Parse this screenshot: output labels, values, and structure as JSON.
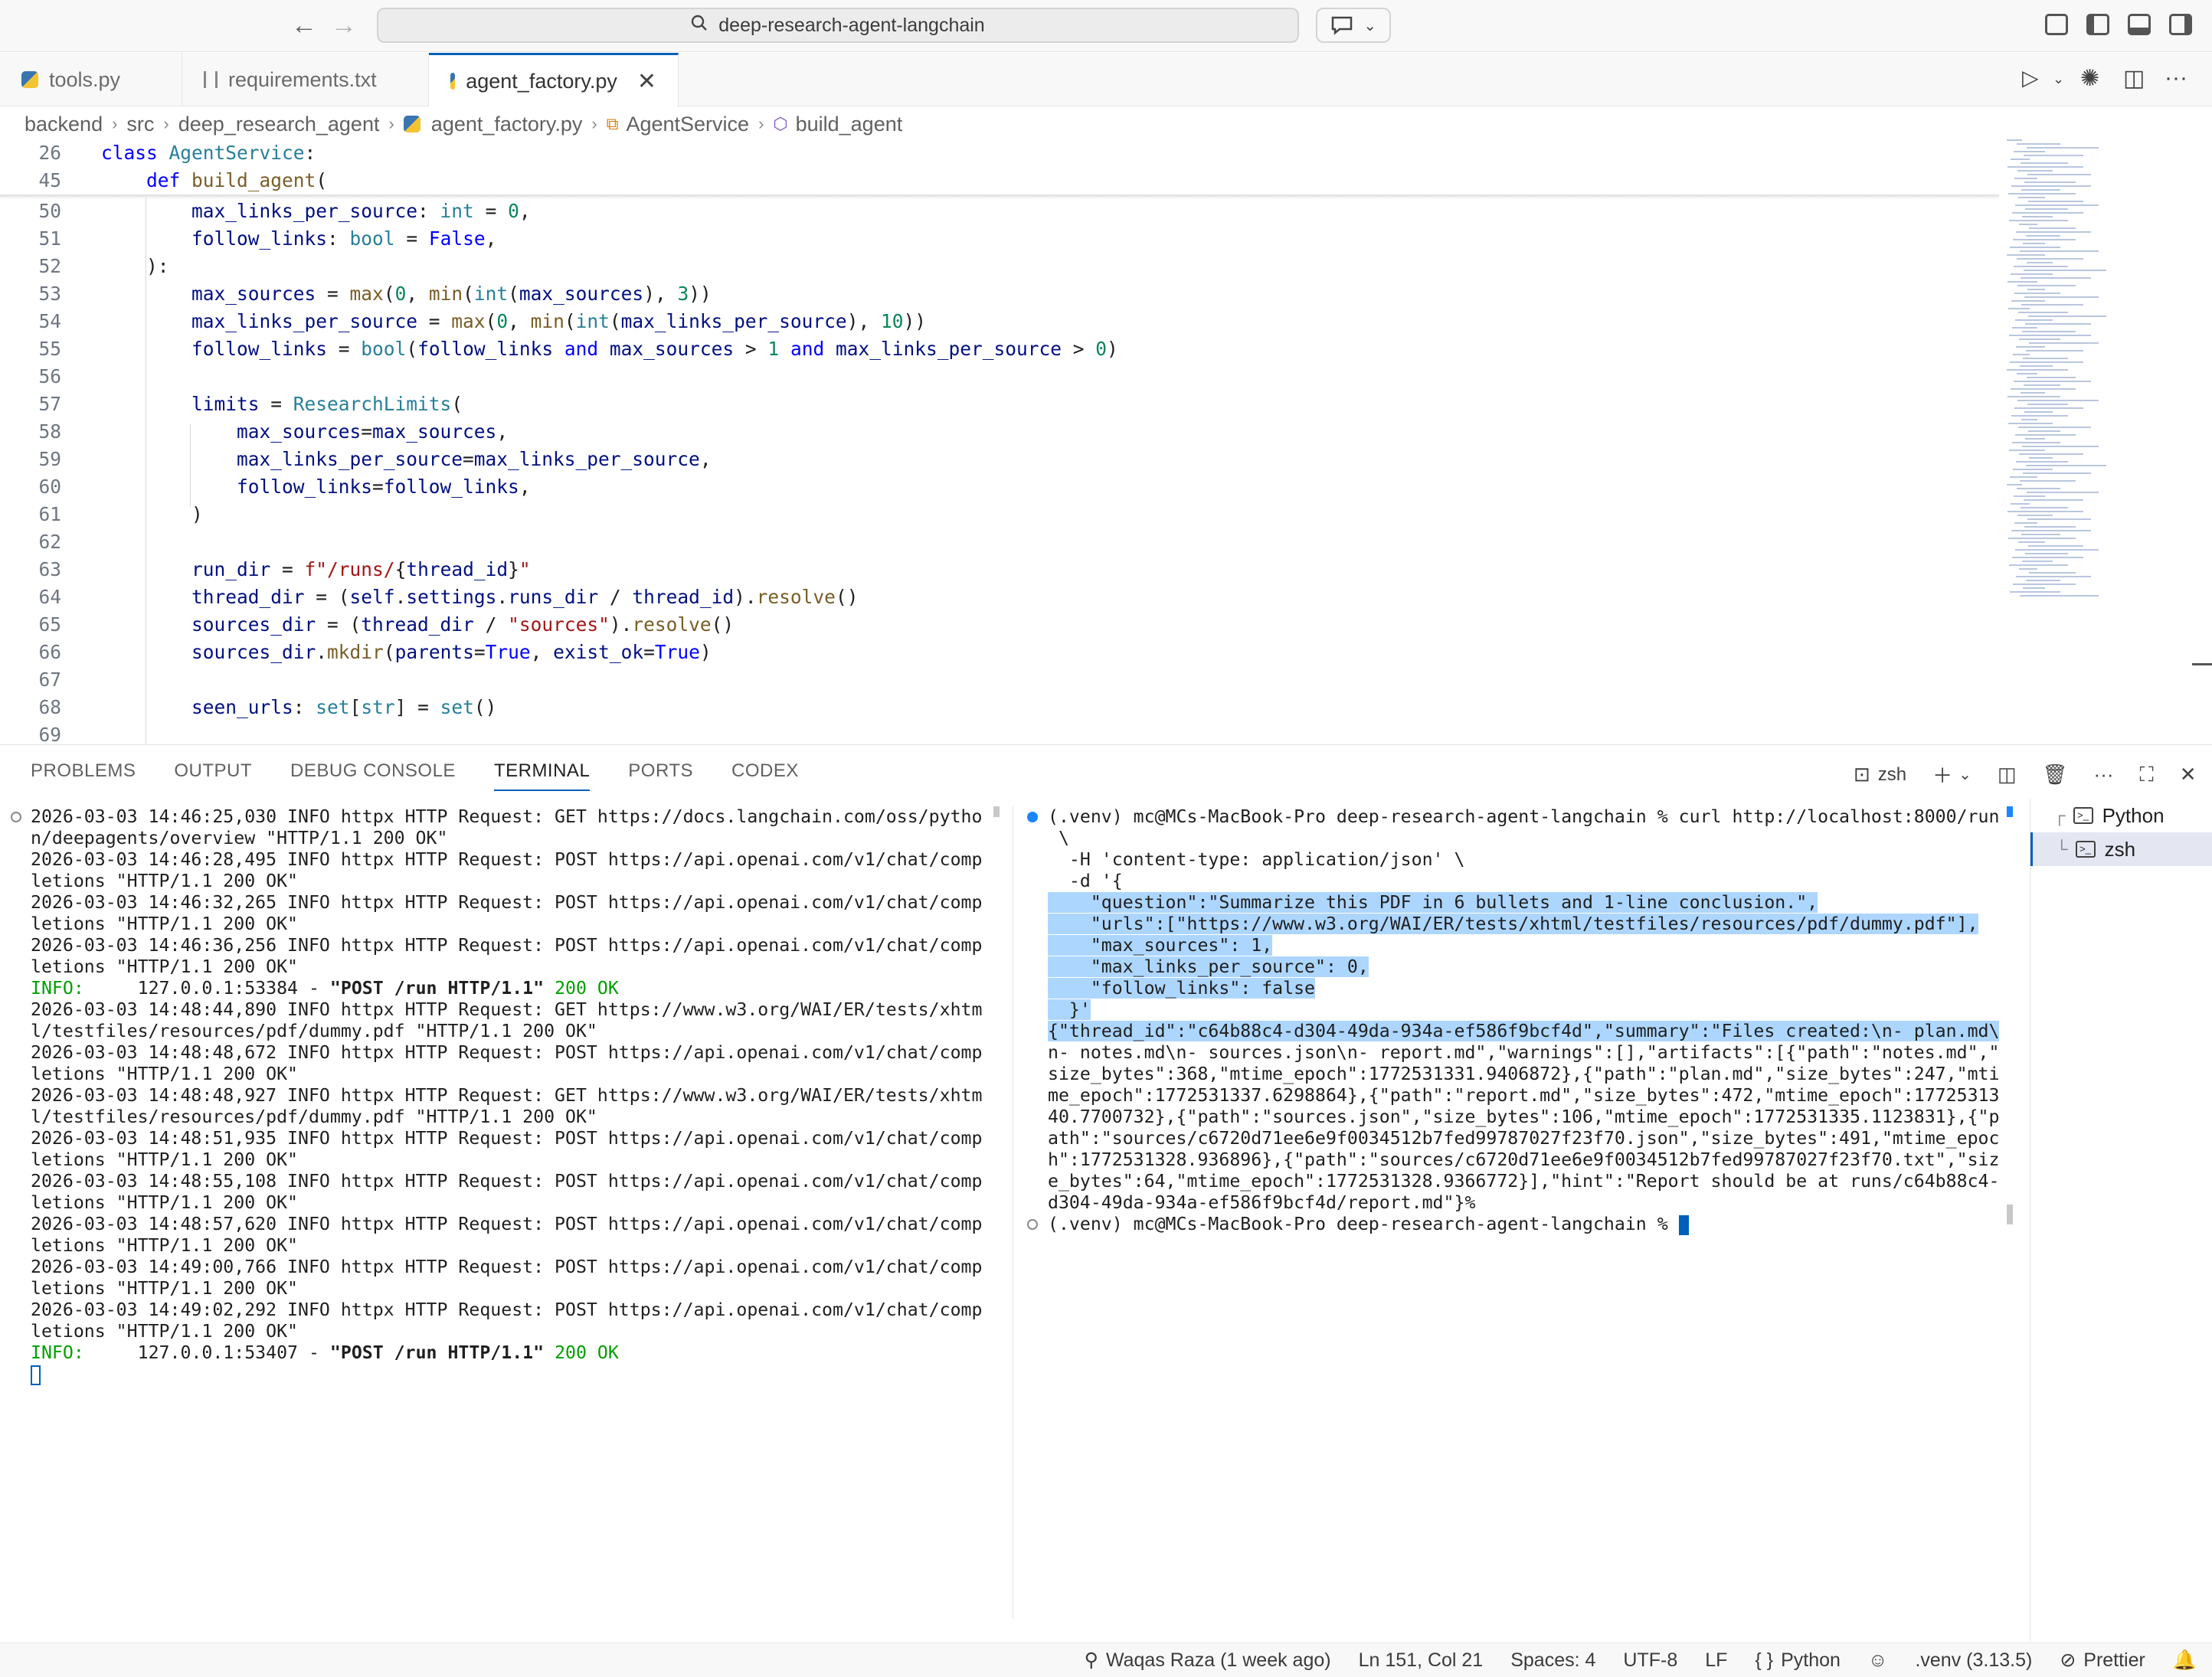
{
  "search": {
    "text": "deep-research-agent-langchain"
  },
  "tabs": [
    {
      "label": "tools.py"
    },
    {
      "label": "requirements.txt"
    },
    {
      "label": "agent_factory.py"
    }
  ],
  "breadcrumb": [
    "backend",
    "src",
    "deep_research_agent",
    "agent_factory.py",
    "AgentService",
    "build_agent"
  ],
  "editor": {
    "sticky": [
      {
        "ln": "26",
        "html": "<span class=\"kw\">class</span> <span class=\"cls\">AgentService</span>:"
      },
      {
        "ln": "45",
        "html": "    <span class=\"kw\">def</span> <span class=\"fn\">build_agent</span>("
      }
    ],
    "lines": [
      {
        "ln": "50",
        "html": "        <span class=\"var\">max_links_per_source</span>: <span class=\"ty\">int</span> = <span class=\"num\">0</span>,"
      },
      {
        "ln": "51",
        "html": "        <span class=\"var\">follow_links</span>: <span class=\"ty\">bool</span> = <span class=\"kw\">False</span>,"
      },
      {
        "ln": "52",
        "html": "    ):"
      },
      {
        "ln": "53",
        "html": "        <span class=\"var\">max_sources</span> = <span class=\"fn\">max</span>(<span class=\"num\">0</span>, <span class=\"fn\">min</span>(<span class=\"ty\">int</span>(<span class=\"var\">max_sources</span>), <span class=\"num\">3</span>))"
      },
      {
        "ln": "54",
        "html": "        <span class=\"var\">max_links_per_source</span> = <span class=\"fn\">max</span>(<span class=\"num\">0</span>, <span class=\"fn\">min</span>(<span class=\"ty\">int</span>(<span class=\"var\">max_links_per_source</span>), <span class=\"num\">10</span>))"
      },
      {
        "ln": "55",
        "html": "        <span class=\"var\">follow_links</span> = <span class=\"ty\">bool</span>(<span class=\"var\">follow_links</span> <span class=\"kw\">and</span> <span class=\"var\">max_sources</span> > <span class=\"num\">1</span> <span class=\"kw\">and</span> <span class=\"var\">max_links_per_source</span> > <span class=\"num\">0</span>)"
      },
      {
        "ln": "56",
        "html": ""
      },
      {
        "ln": "57",
        "html": "        <span class=\"var\">limits</span> = <span class=\"cls\">ResearchLimits</span>("
      },
      {
        "ln": "58",
        "html": "            <span class=\"var\">max_sources</span>=<span class=\"var\">max_sources</span>,"
      },
      {
        "ln": "59",
        "html": "            <span class=\"var\">max_links_per_source</span>=<span class=\"var\">max_links_per_source</span>,"
      },
      {
        "ln": "60",
        "html": "            <span class=\"var\">follow_links</span>=<span class=\"var\">follow_links</span>,"
      },
      {
        "ln": "61",
        "html": "        )"
      },
      {
        "ln": "62",
        "html": ""
      },
      {
        "ln": "63",
        "html": "        <span class=\"var\">run_dir</span> = <span class=\"str\">f\"/runs/</span>{<span class=\"var\">thread_id</span>}<span class=\"str\">\"</span>"
      },
      {
        "ln": "64",
        "html": "        <span class=\"var\">thread_dir</span> = (<span class=\"var\">self</span>.<span class=\"var\">settings</span>.<span class=\"var\">runs_dir</span> / <span class=\"var\">thread_id</span>).<span class=\"fn\">resolve</span>()"
      },
      {
        "ln": "65",
        "html": "        <span class=\"var\">sources_dir</span> = (<span class=\"var\">thread_dir</span> / <span class=\"str\">\"sources\"</span>).<span class=\"fn\">resolve</span>()"
      },
      {
        "ln": "66",
        "html": "        <span class=\"var\">sources_dir</span>.<span class=\"fn\">mkdir</span>(<span class=\"var\">parents</span>=<span class=\"kw\">True</span>, <span class=\"var\">exist_ok</span>=<span class=\"kw\">True</span>)"
      },
      {
        "ln": "67",
        "html": ""
      },
      {
        "ln": "68",
        "html": "        <span class=\"var\">seen_urls</span>: <span class=\"ty\">set</span>[<span class=\"ty\">str</span>] = <span class=\"ty\">set</span>()"
      },
      {
        "ln": "69",
        "html": ""
      }
    ]
  },
  "panel": {
    "tabs": [
      "PROBLEMS",
      "OUTPUT",
      "DEBUG CONSOLE",
      "TERMINAL",
      "PORTS",
      "CODEX"
    ],
    "active_tab": "TERMINAL",
    "shell_label": "zsh",
    "terminals": [
      "Python",
      "zsh"
    ]
  },
  "terminal_left": [
    "2026-03-03 14:46:25,030 INFO httpx HTTP Request: GET https://docs.langchain.com/oss/pytho",
    "n/deepagents/overview \"HTTP/1.1 200 OK\"",
    "2026-03-03 14:46:28,495 INFO httpx HTTP Request: POST https://api.openai.com/v1/chat/comp",
    "letions \"HTTP/1.1 200 OK\"",
    "2026-03-03 14:46:32,265 INFO httpx HTTP Request: POST https://api.openai.com/v1/chat/comp",
    "letions \"HTTP/1.1 200 OK\"",
    "2026-03-03 14:46:36,256 INFO httpx HTTP Request: POST https://api.openai.com/v1/chat/comp",
    "letions \"HTTP/1.1 200 OK\"",
    "INFO:     127.0.0.1:53384 - \"POST /run HTTP/1.1\" 200 OK",
    "2026-03-03 14:48:44,890 INFO httpx HTTP Request: GET https://www.w3.org/WAI/ER/tests/xhtm",
    "l/testfiles/resources/pdf/dummy.pdf \"HTTP/1.1 200 OK\"",
    "2026-03-03 14:48:48,672 INFO httpx HTTP Request: POST https://api.openai.com/v1/chat/comp",
    "letions \"HTTP/1.1 200 OK\"",
    "2026-03-03 14:48:48,927 INFO httpx HTTP Request: GET https://www.w3.org/WAI/ER/tests/xhtm",
    "l/testfiles/resources/pdf/dummy.pdf \"HTTP/1.1 200 OK\"",
    "2026-03-03 14:48:51,935 INFO httpx HTTP Request: POST https://api.openai.com/v1/chat/comp",
    "letions \"HTTP/1.1 200 OK\"",
    "2026-03-03 14:48:55,108 INFO httpx HTTP Request: POST https://api.openai.com/v1/chat/comp",
    "letions \"HTTP/1.1 200 OK\"",
    "2026-03-03 14:48:57,620 INFO httpx HTTP Request: POST https://api.openai.com/v1/chat/comp",
    "letions \"HTTP/1.1 200 OK\"",
    "2026-03-03 14:49:00,766 INFO httpx HTTP Request: POST https://api.openai.com/v1/chat/comp",
    "letions \"HTTP/1.1 200 OK\"",
    "2026-03-03 14:49:02,292 INFO httpx HTTP Request: POST https://api.openai.com/v1/chat/comp",
    "letions \"HTTP/1.1 200 OK\"",
    "INFO:     127.0.0.1:53407 - \"POST /run HTTP/1.1\" 200 OK"
  ],
  "terminal_right": [
    {
      "t": "(.venv) mc@MCs-MacBook-Pro deep-research-agent-langchain % curl http://localhost:8000/run",
      "sel": false
    },
    {
      "t": " \\",
      "sel": false
    },
    {
      "t": "  -H 'content-type: application/json' \\",
      "sel": false
    },
    {
      "t": "  -d '{",
      "sel": false
    },
    {
      "t": "    \"question\":\"Summarize this PDF in 6 bullets and 1-line conclusion.\",",
      "sel": true
    },
    {
      "t": "    \"urls\":[\"https://www.w3.org/WAI/ER/tests/xhtml/testfiles/resources/pdf/dummy.pdf\"],",
      "sel": true
    },
    {
      "t": "    \"max_sources\": 1,",
      "sel": true
    },
    {
      "t": "    \"max_links_per_source\": 0,",
      "sel": true
    },
    {
      "t": "    \"follow_links\": false",
      "sel": true
    },
    {
      "t": "  }'",
      "sel": true
    },
    {
      "t": "{\"thread_id\":\"c64b88c4-d304-49da-934a-ef586f9bcf4d\",\"summary\":\"Files created:\\n- plan.md\\",
      "sel": true
    },
    {
      "t": "n- notes.md\\n- sources.json\\n- report.md\",\"warnings\":[],\"artifacts\":[{\"path\":\"notes.md\",\"",
      "sel": false
    },
    {
      "t": "size_bytes\":368,\"mtime_epoch\":1772531331.9406872},{\"path\":\"plan.md\",\"size_bytes\":247,\"mti",
      "sel": false
    },
    {
      "t": "me_epoch\":1772531337.6298864},{\"path\":\"report.md\",\"size_bytes\":472,\"mtime_epoch\":17725313",
      "sel": false
    },
    {
      "t": "40.7700732},{\"path\":\"sources.json\",\"size_bytes\":106,\"mtime_epoch\":1772531335.1123831},{\"p",
      "sel": false
    },
    {
      "t": "ath\":\"sources/c6720d71ee6e9f0034512b7fed99787027f23f70.json\",\"size_bytes\":491,\"mtime_epoc",
      "sel": false
    },
    {
      "t": "h\":1772531328.936896},{\"path\":\"sources/c6720d71ee6e9f0034512b7fed99787027f23f70.txt\",\"siz",
      "sel": false
    },
    {
      "t": "e_bytes\":64,\"mtime_epoch\":1772531328.9366772}],\"hint\":\"Report should be at runs/c64b88c4-",
      "sel": false
    },
    {
      "t": "d304-49da-934a-ef586f9bcf4d/report.md\"}%",
      "sel": false
    },
    {
      "t": "(.venv) mc@MCs-MacBook-Pro deep-research-agent-langchain % ",
      "sel": false
    }
  ],
  "status": {
    "author": "Waqas Raza (1 week ago)",
    "position": "Ln 151, Col 21",
    "spaces": "Spaces: 4",
    "encoding": "UTF-8",
    "eol": "LF",
    "language": "Python",
    "venv": ".venv (3.13.5)",
    "formatter": "Prettier"
  },
  "colors": {
    "accent": "#005fb8",
    "selection": "#add6ff",
    "info_green": "#00a000"
  }
}
